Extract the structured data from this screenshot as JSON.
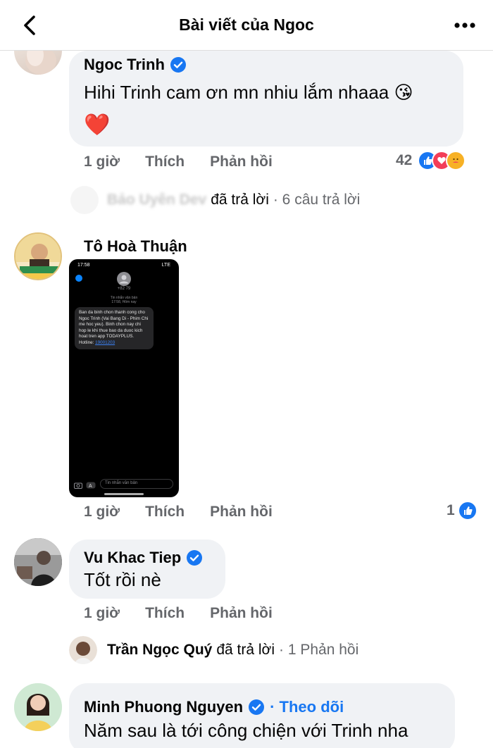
{
  "header": {
    "title": "Bài viết của Ngoc"
  },
  "comments": [
    {
      "author": "Ngoc Trinh",
      "text": "Hihi Trinh cam ơn mn nhiu lắm nhaaa 😘",
      "emoji_line": "❤️",
      "time": "1 giờ",
      "like": "Thích",
      "reply": "Phản hồi",
      "reaction_count": "42",
      "replies": {
        "who": "Bảo Uyên Dev",
        "action": "đã trả lời",
        "count": "· 6 câu trả lời"
      }
    },
    {
      "author": "Tô Hoà Thuận",
      "time": "1 giờ",
      "like": "Thích",
      "reply": "Phản hồi",
      "reaction_count": "1",
      "screenshot": {
        "status_time": "17:58",
        "status_right": "LTE",
        "sender": "+82 79",
        "meta1": "Tin nhắn văn bản",
        "meta2": "17:58, Hôm nay",
        "sms": "Ban da binh chon thanh cong cho Ngoc Trinh (Vai Bang Di - Phim Chi me hoc yeu). Binh chon nay chi hop le khi thue bao da duoc kich hoat tren app TODAYPLUS. Hotline: ",
        "hotline": "19001203",
        "input_placeholder": "Tin nhắn văn bản"
      }
    },
    {
      "author": "Vu Khac Tiep",
      "text": "Tốt rồi nè",
      "time": "1 giờ",
      "like": "Thích",
      "reply": "Phản hồi",
      "replies": {
        "who": "Trần Ngọc Quý",
        "action": "đã trả lời",
        "count": "· 1 Phản hồi"
      }
    },
    {
      "author": "Minh Phuong Nguyen",
      "follow": "· Theo dõi",
      "text": "Năm sau là tới công chiện với Trinh nha"
    }
  ],
  "colors": {
    "accent": "#1877f2",
    "bubble": "#f0f2f5",
    "muted": "#65676b",
    "heart": "#f33e58"
  }
}
